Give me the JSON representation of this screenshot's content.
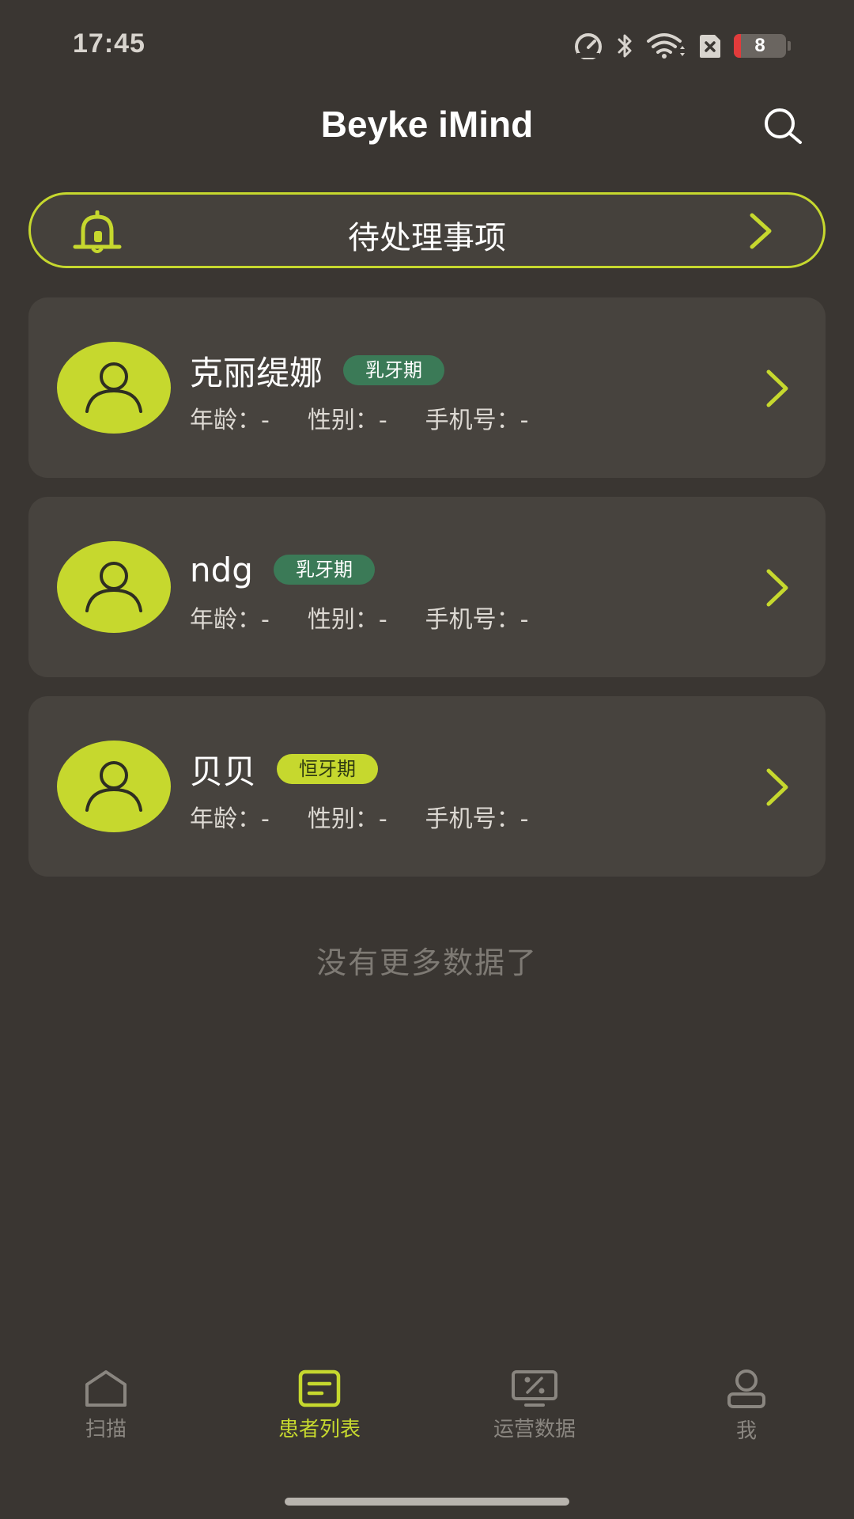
{
  "status_bar": {
    "time": "17:45",
    "battery_level": "8",
    "icons": [
      "speedometer-icon",
      "bluetooth-icon",
      "wifi-icon",
      "sim-x-icon",
      "battery-icon"
    ]
  },
  "header": {
    "title": "Beyke iMind",
    "search_icon": "search-icon"
  },
  "pending": {
    "label": "待处理事项",
    "icon": "bell-icon"
  },
  "patients": [
    {
      "name": "克丽缇娜",
      "stage": "乳牙期",
      "stage_color": "#3b7a57",
      "age_label": "年龄：-",
      "gender_label": "性别：-",
      "phone_label": "手机号：-"
    },
    {
      "name": "ndg",
      "stage": "乳牙期",
      "stage_color": "#3b7a57",
      "age_label": "年龄：-",
      "gender_label": "性别：-",
      "phone_label": "手机号：-"
    },
    {
      "name": "贝贝",
      "stage": "恒牙期",
      "stage_color": "#c6d82e",
      "age_label": "年龄：-",
      "gender_label": "性别：-",
      "phone_label": "手机号：-"
    }
  ],
  "list_end_text": "没有更多数据了",
  "nav": {
    "items": [
      {
        "label": "扫描",
        "icon": "home-icon",
        "active": false
      },
      {
        "label": "患者列表",
        "icon": "list-icon",
        "active": true
      },
      {
        "label": "运营数据",
        "icon": "monitor-percent-icon",
        "active": false
      },
      {
        "label": "我",
        "icon": "user-icon",
        "active": false
      }
    ]
  },
  "colors": {
    "background": "#3a3632",
    "card": "#47433e",
    "accent": "#c6d82e",
    "badge_green": "#3b7a57"
  }
}
